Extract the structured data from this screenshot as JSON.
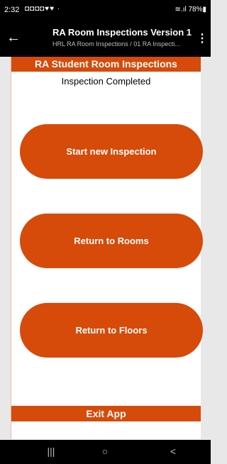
{
  "status_bar": {
    "time": "2:32",
    "notification_icons": "◘◘◘◘♥♥ ·",
    "right": "≋.ıl 78%▮"
  },
  "app_bar": {
    "back_glyph": "←",
    "title": "RA Room Inspections Version 1",
    "subtitle": "HRL RA Room Inspections / 01 RA Inspecti...",
    "more_glyph": "⋮"
  },
  "screen": {
    "header": "RA Student Room Inspections",
    "status_text": "Inspection Completed",
    "buttons": {
      "start_new": "Start new Inspection",
      "return_rooms": "Return to Rooms",
      "return_floors": "Return to Floors"
    },
    "exit": "Exit App"
  },
  "nav_bar": {
    "recents": "|||",
    "home": "○",
    "back": "<"
  },
  "colors": {
    "accent": "#d64a0a",
    "system_bars": "#000000"
  }
}
